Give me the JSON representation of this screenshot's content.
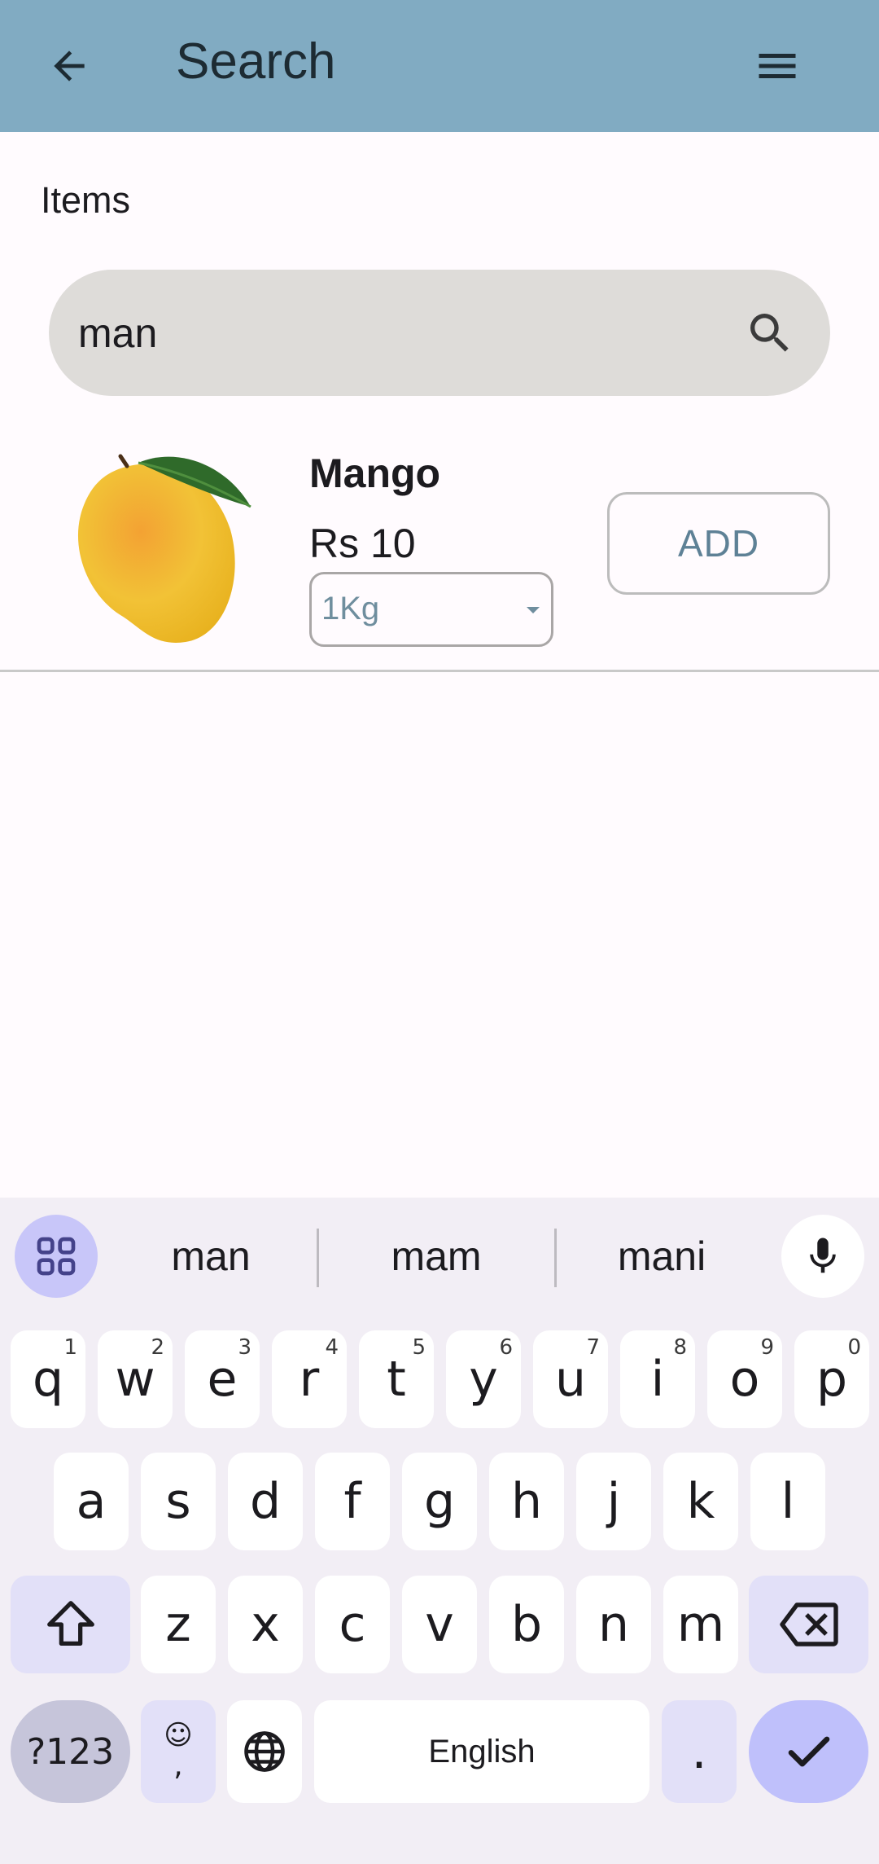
{
  "app_bar": {
    "title": "Search"
  },
  "section": {
    "label": "Items"
  },
  "search": {
    "value": "man"
  },
  "product": {
    "name": "Mango",
    "price": "Rs 10",
    "unit": "1Kg",
    "add_label": "ADD"
  },
  "keyboard": {
    "suggestions": [
      "man",
      "mam",
      "mani"
    ],
    "row1": [
      {
        "k": "q",
        "h": "1"
      },
      {
        "k": "w",
        "h": "2"
      },
      {
        "k": "e",
        "h": "3"
      },
      {
        "k": "r",
        "h": "4"
      },
      {
        "k": "t",
        "h": "5"
      },
      {
        "k": "y",
        "h": "6"
      },
      {
        "k": "u",
        "h": "7"
      },
      {
        "k": "i",
        "h": "8"
      },
      {
        "k": "o",
        "h": "9"
      },
      {
        "k": "p",
        "h": "0"
      }
    ],
    "row2": [
      "a",
      "s",
      "d",
      "f",
      "g",
      "h",
      "j",
      "k",
      "l"
    ],
    "row3": [
      "z",
      "x",
      "c",
      "v",
      "b",
      "n",
      "m"
    ],
    "symbols_label": "?123",
    "emoji_comma": ",",
    "space_label": "English",
    "period": "."
  },
  "colors": {
    "app_bar": "#81abc2",
    "accent": "#5e8196",
    "keyboard_bg": "#f2eef5",
    "enter_key": "#bfc0fb"
  }
}
